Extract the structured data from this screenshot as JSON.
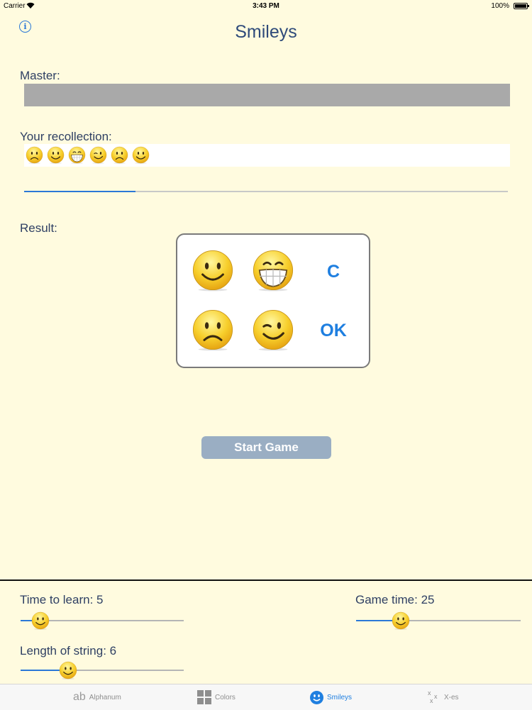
{
  "status_bar": {
    "carrier": "Carrier",
    "time": "3:43 PM",
    "battery": "100%"
  },
  "title": "Smileys",
  "master": {
    "label": "Master:"
  },
  "recollection": {
    "label": "Your recollection:",
    "faces": [
      "sad",
      "smile",
      "grin",
      "wink",
      "sad",
      "smile"
    ]
  },
  "progress": {
    "value": 0.23
  },
  "result": {
    "label": "Result:"
  },
  "keypad": {
    "keys": [
      {
        "icon": "smile"
      },
      {
        "icon": "grin"
      },
      {
        "label": "C"
      },
      {
        "icon": "sad"
      },
      {
        "icon": "wink"
      },
      {
        "label": "OK"
      }
    ]
  },
  "start_button": {
    "label": "Start Game"
  },
  "settings": {
    "time_to_learn": {
      "label": "Time to learn: 5",
      "fraction": 0.12
    },
    "game_time": {
      "label": "Game time: 25",
      "fraction": 0.27
    },
    "length_of_string": {
      "label": "Length of string: 6",
      "fraction": 0.29
    }
  },
  "tabs": [
    {
      "label": "Alphanum",
      "icon": "ab-icon",
      "glyph": "ab",
      "active": false
    },
    {
      "label": "Colors",
      "icon": "grid-icon",
      "active": false
    },
    {
      "label": "Smileys",
      "icon": "smiley-icon",
      "active": true
    },
    {
      "label": "X-es",
      "icon": "x-es-icon",
      "glyph": "x",
      "active": false
    }
  ],
  "colors": {
    "background": "#fffbdf",
    "accent": "#1f7fe0",
    "button": "#9aaec3"
  }
}
